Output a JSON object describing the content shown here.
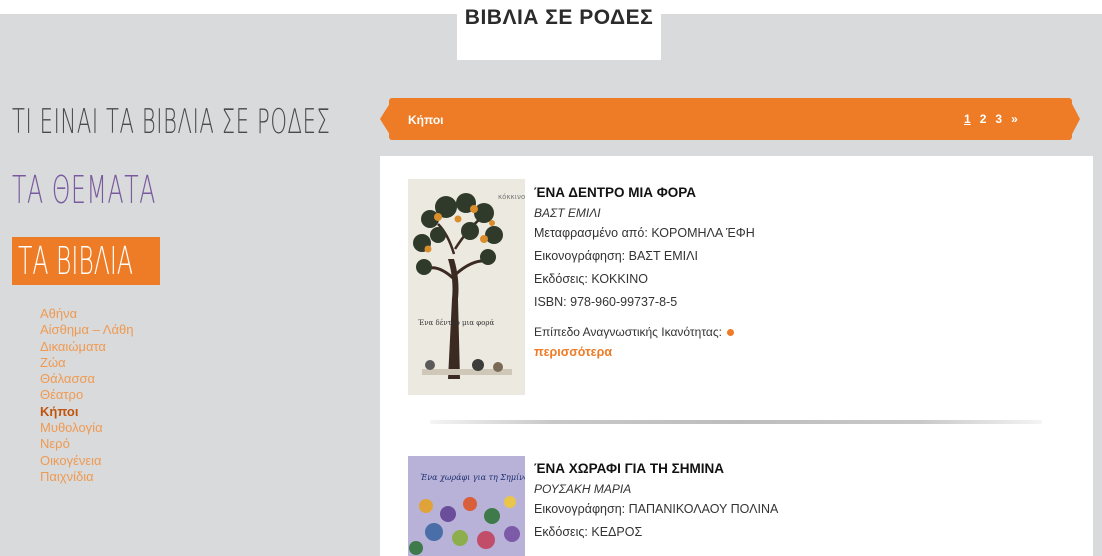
{
  "site": {
    "logo_text": "ΒΙΒΛΙΑ ΣΕ ΡΟΔΕΣ"
  },
  "sidebar": {
    "heading_about": "ΤΙ ΕΙΝΑΙ ΤΑ ΒΙΒΛΙΑ ΣΕ ΡΟΔΕΣ",
    "heading_topics": "ΤΑ ΘΕΜΑΤΑ",
    "heading_books": "ΤΑ ΒΙΒΛΙΑ",
    "categories": [
      {
        "label": "Αθήνα",
        "active": false
      },
      {
        "label": "Αίσθημα – Λάθη",
        "active": false
      },
      {
        "label": "Δικαιώματα",
        "active": false
      },
      {
        "label": "Ζώα",
        "active": false
      },
      {
        "label": "Θάλασσα",
        "active": false
      },
      {
        "label": "Θέατρο",
        "active": false
      },
      {
        "label": "Κήποι",
        "active": true
      },
      {
        "label": "Μυθολογία",
        "active": false
      },
      {
        "label": "Νερό",
        "active": false
      },
      {
        "label": "Οικογένεια",
        "active": false
      },
      {
        "label": "Παιχνίδια",
        "active": false
      }
    ]
  },
  "section": {
    "title": "Κήποι",
    "pages": [
      "1",
      "2",
      "3",
      "»"
    ],
    "current_page": "1"
  },
  "books": [
    {
      "title": "ΈΝΑ ΔΕΝΤΡΟ ΜΙΑ ΦΟΡΑ",
      "author": "ΒΑΣΤ ΕΜΙΛΙ",
      "translation": "Μεταφρασμένο από: ΚΟΡΟΜΗΛΑ ΈΦΗ",
      "illustration": "Εικονογράφηση: ΒΑΣΤ ΕΜΙΛΙ",
      "publisher": "Εκδόσεις: ΚΟΚΚΙΝΟ",
      "isbn": "ISBN: 978-960-99737-8-5",
      "level_label": "Επίπεδο Αναγνωστικής Ικανότητας:",
      "more": "περισσότερα"
    },
    {
      "title": "ΈΝΑ ΧΩΡΑΦΙ ΓΙΑ ΤΗ ΣΗΜΙΝΑ",
      "author": "ΡΟΥΣΑΚΗ ΜΑΡΙΑ",
      "illustration": "Εικονογράφηση: ΠΑΠΑΝΙΚΟΛΑΟΥ ΠΟΛΙΝΑ",
      "publisher": "Εκδόσεις: ΚΕΔΡΟΣ"
    }
  ],
  "colors": {
    "accent": "#ee7b25",
    "background": "#d9dadb",
    "topics": "#7a5a9e"
  }
}
